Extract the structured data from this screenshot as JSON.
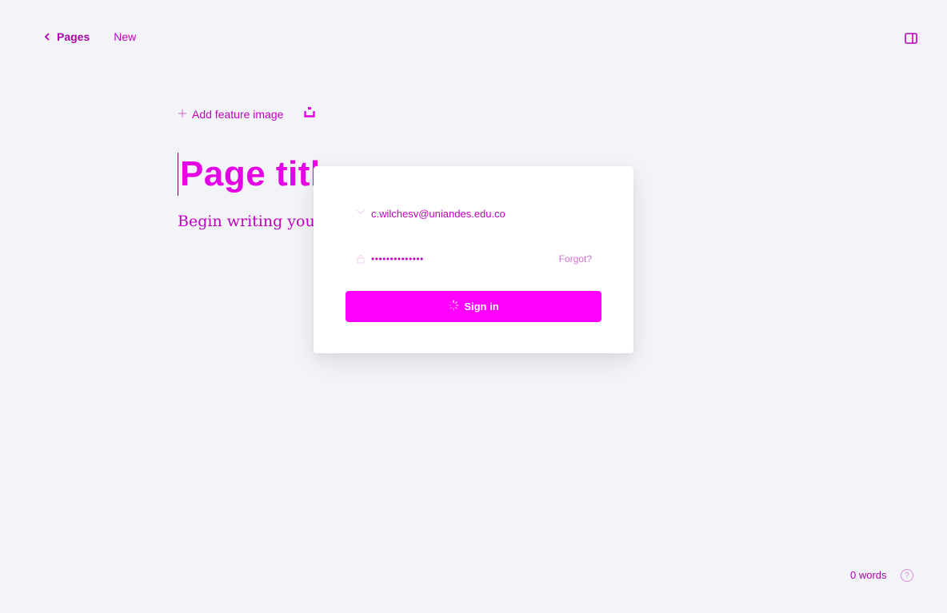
{
  "nav": {
    "back_label": "Pages",
    "status_label": "New"
  },
  "editor": {
    "add_feature_label": "Add feature image",
    "title": "Page title",
    "body_placeholder": "Begin writing your page..."
  },
  "signin_modal": {
    "email_value": "c.wilchesv@uniandes.edu.co",
    "password_masked": "••••••••••••••",
    "forgot_label": "Forgot?",
    "submit_label": "Sign in"
  },
  "footer": {
    "word_count": "0 words",
    "help_label": "?"
  },
  "colors": {
    "accent": "#ff00ff",
    "text_accent": "#c000c0",
    "background": "#f3f4f8"
  },
  "icons": [
    "chevron-left-icon",
    "sidebar-toggle-icon",
    "plus-icon",
    "snippet-icon",
    "email-icon",
    "lock-icon",
    "spinner-icon",
    "help-icon"
  ]
}
